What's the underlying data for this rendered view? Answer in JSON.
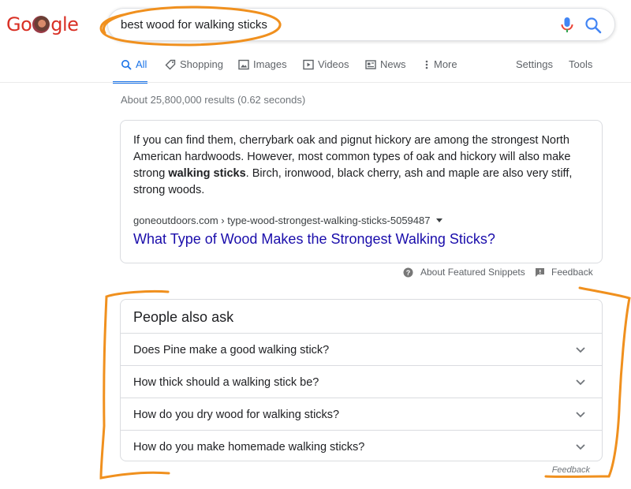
{
  "logo": {
    "g": "Go",
    "l": "gle"
  },
  "search": {
    "query": "best wood for walking sticks"
  },
  "tabs": [
    {
      "label": "All",
      "icon": "search-icon"
    },
    {
      "label": "Shopping",
      "icon": "tag-icon"
    },
    {
      "label": "Images",
      "icon": "image-icon"
    },
    {
      "label": "Videos",
      "icon": "play-icon"
    },
    {
      "label": "News",
      "icon": "newspaper-icon"
    },
    {
      "label": "More",
      "icon": "kebab-icon"
    },
    {
      "label": "Settings"
    },
    {
      "label": "Tools"
    }
  ],
  "stats": "About 25,800,000 results (0.62 seconds)",
  "snippet": {
    "text_before": "If you can find them, cherrybark oak and pignut hickory are among the strongest North American hardwoods. However, most common types of oak and hickory will also make strong ",
    "bold": "walking sticks",
    "text_after": ". Birch, ironwood, black cherry, ash and maple are also very stiff, strong woods.",
    "cite": "goneoutdoors.com › type-wood-strongest-walking-sticks-5059487",
    "link": "What Type of Wood Makes the Strongest Walking Sticks?"
  },
  "under_snippet": {
    "about": "About Featured Snippets",
    "feedback": "Feedback"
  },
  "paa": {
    "title": "People also ask",
    "questions": [
      "Does Pine make a good walking stick?",
      "How thick should a walking stick be?",
      "How do you dry wood for walking sticks?",
      "How do you make homemade walking sticks?"
    ],
    "feedback": "Feedback"
  },
  "colors": {
    "accent": "#1a73e8",
    "link": "#1a0dab",
    "annotation": "#f0901e"
  }
}
